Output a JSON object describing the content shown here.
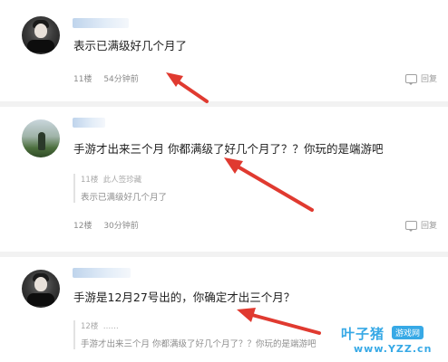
{
  "posts": [
    {
      "content": "表示已满级好几个月了",
      "floor": "11楼",
      "time": "54分钟前",
      "reply": "回复"
    },
    {
      "content": "手游才出来三个月   你都满级了好几个月了？？你玩的是端游吧",
      "quote": {
        "floor": "11楼",
        "note": "此人签珍藏",
        "text": "表示已满级好几个月了"
      },
      "floor": "12楼",
      "time": "30分钟前",
      "reply": "回复"
    },
    {
      "content": "手游是12月27号出的，你确定才出三个月？",
      "quote": {
        "floor": "12楼",
        "note": "……",
        "text": "手游才出来三个月    你都满级了好几个月了？？你玩的是端游吧"
      }
    }
  ],
  "watermark": {
    "main": "叶子猪",
    "badge": "游戏网",
    "url": "www.YZZ.cn"
  },
  "colors": {
    "arrow": "#e03a30",
    "watermark": "#37a9e6"
  }
}
